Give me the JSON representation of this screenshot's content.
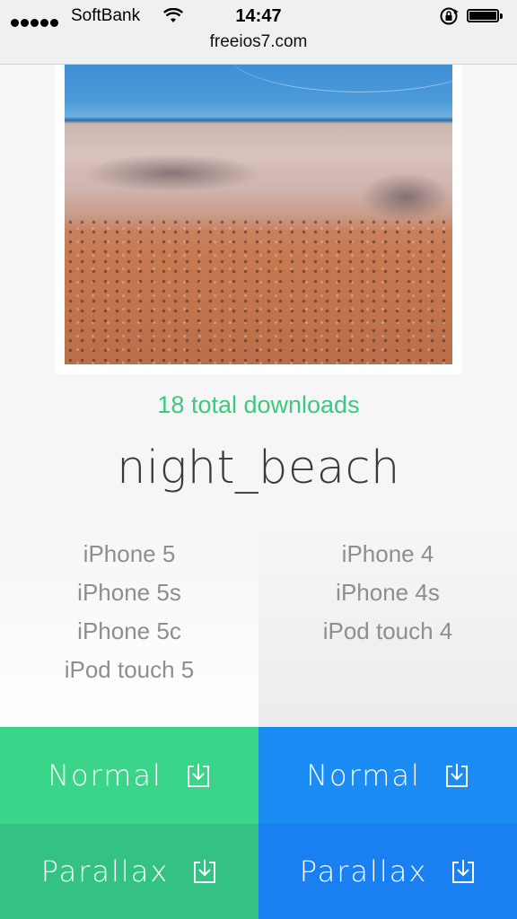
{
  "status_bar": {
    "carrier": "SoftBank",
    "time": "14:47",
    "signal_dots": 5,
    "battery_level": 0.9
  },
  "browser": {
    "url": "freeios7.com"
  },
  "wallpaper": {
    "downloads_text": "18 total downloads",
    "name": "night_beach"
  },
  "devices": {
    "left": [
      "iPhone 5",
      "iPhone 5s",
      "iPhone 5c",
      "iPod touch 5"
    ],
    "right": [
      "iPhone 4",
      "iPhone 4s",
      "iPod touch 4"
    ]
  },
  "buttons": {
    "left_normal": "Normal",
    "right_normal": "Normal",
    "left_parallax": "Parallax",
    "right_parallax": "Parallax"
  },
  "colors": {
    "accent_green": "#3ad588",
    "accent_blue": "#1b8cf4",
    "downloads_green": "#3ac97f"
  },
  "icons": {
    "signal": "signal-dots-icon",
    "wifi": "wifi-icon",
    "rotation_lock": "rotation-lock-icon",
    "battery": "battery-icon",
    "download": "download-icon"
  }
}
